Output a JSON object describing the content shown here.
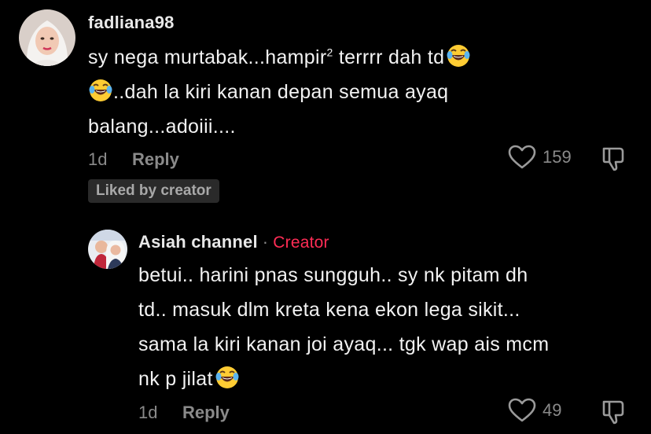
{
  "comments": [
    {
      "username": "fadliana98",
      "lines": [
        "sy nega murtabak...hampir",
        "2",
        " terrrr dah td",
        "..dah la kiri kanan depan semua ayaq",
        "balang...adoiii...."
      ],
      "time": "1d",
      "reply_label": "Reply",
      "likes": "159",
      "liked_by_creator": "Liked by creator",
      "avatar": "woman-hijab-avatar"
    },
    {
      "username": "Asiah channel",
      "separator": "·",
      "creator_label": "Creator",
      "lines": [
        "betui.. harini pnas sungguh.. sy nk pitam dh",
        "td.. masuk dlm kreta kena ekon lega sikit...",
        "sama la kiri kanan joi ayaq... tgk wap ais mcm",
        "nk p jilat"
      ],
      "time": "1d",
      "reply_label": "Reply",
      "likes": "49",
      "avatar": "couple-photo-avatar"
    }
  ],
  "colors": {
    "background": "#000000",
    "text": "#f2f2f2",
    "muted": "#8a8a8a",
    "creator": "#fe2c55",
    "badge_bg": "#2a2a2a"
  },
  "icons": [
    "heart-outline-icon",
    "dislike-icon",
    "laughing-tears-emoji"
  ]
}
